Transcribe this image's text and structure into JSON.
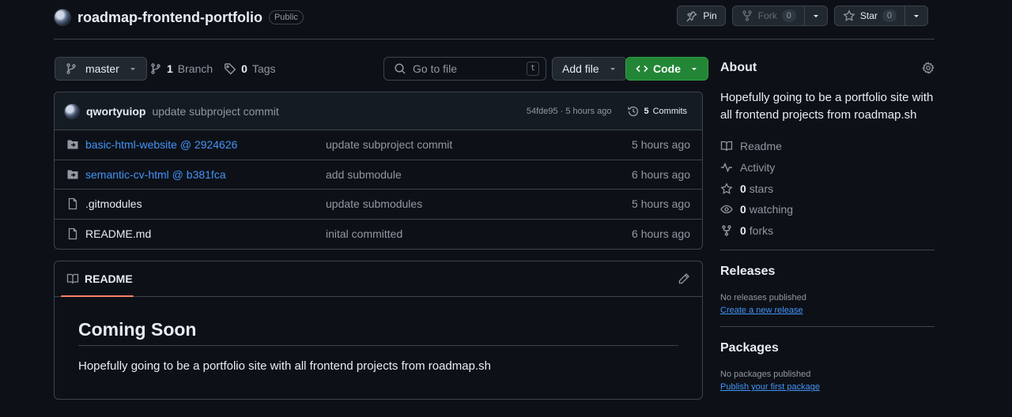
{
  "repo": {
    "name": "roadmap-frontend-portfolio",
    "visibility": "Public"
  },
  "header_actions": {
    "pin_label": "Pin",
    "fork_label": "Fork",
    "fork_count": "0",
    "star_label": "Star",
    "star_count": "0"
  },
  "toolbar": {
    "branch": "master",
    "branch_count": "1",
    "branch_label": "Branch",
    "tag_count": "0",
    "tag_label": "Tags",
    "goto_placeholder": "Go to file",
    "goto_shortcut": "t",
    "add_file_label": "Add file",
    "code_label": "Code"
  },
  "latest_commit": {
    "author": "qwortyuiop",
    "message": "update subproject commit",
    "meta": "54fde95 · 5 hours ago",
    "commits_count": "5",
    "commits_label": "Commits"
  },
  "files": [
    {
      "name": "basic-html-website @ 2924626",
      "type": "submodule",
      "message": "update subproject commit",
      "time": "5 hours ago"
    },
    {
      "name": "semantic-cv-html @ b381fca",
      "type": "submodule",
      "message": "add submodule",
      "time": "6 hours ago"
    },
    {
      "name": ".gitmodules",
      "type": "file",
      "message": "update submodules",
      "time": "5 hours ago"
    },
    {
      "name": "README.md",
      "type": "file",
      "message": "inital committed",
      "time": "6 hours ago"
    }
  ],
  "readme": {
    "tab_label": "README",
    "heading": "Coming Soon",
    "body": "Hopefully going to be a portfolio site with all frontend projects from roadmap.sh"
  },
  "sidebar": {
    "about_title": "About",
    "about_desc": "Hopefully going to be a portfolio site with all frontend projects from roadmap.sh",
    "links": [
      {
        "icon": "book-icon",
        "label": "Readme"
      },
      {
        "icon": "pulse-icon",
        "label": "Activity"
      }
    ],
    "stats": [
      {
        "icon": "star-icon",
        "count": "0",
        "label": "stars"
      },
      {
        "icon": "eye-icon",
        "count": "0",
        "label": "watching"
      },
      {
        "icon": "fork-icon",
        "count": "0",
        "label": "forks"
      }
    ],
    "releases": {
      "title": "Releases",
      "empty": "No releases published",
      "link": "Create a new release"
    },
    "packages": {
      "title": "Packages",
      "empty": "No packages published",
      "link": "Publish your first package"
    }
  },
  "colors": {
    "bg": "#0d1117",
    "border": "#3d444d",
    "link": "#4493f8",
    "code_green": "#238636",
    "tab_accent": "#f78166"
  }
}
